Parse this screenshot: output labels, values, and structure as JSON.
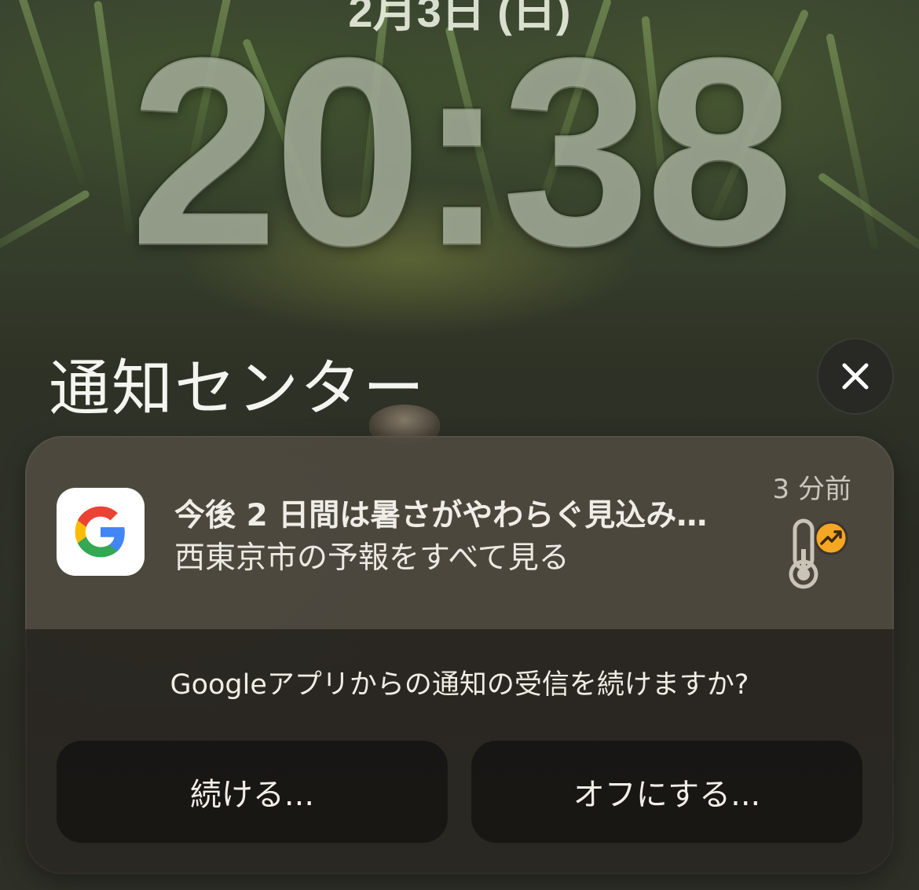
{
  "lock_screen": {
    "date": "2月3日 (日)",
    "time": "20:38"
  },
  "notification_center": {
    "title": "通知センター",
    "close_icon": "close-icon"
  },
  "notification": {
    "app_icon": "google-g-icon",
    "title": "今後 2 日間は暑さがやわらぐ見込み…",
    "body": "西東京市の予報をすべて見る",
    "time_ago": "3 分前",
    "thumbnail_icon": "thermometer-trend-up-icon",
    "accent_color": "#f5a623"
  },
  "notification_prompt": {
    "question": "Googleアプリからの通知の受信を続けますか?",
    "continue_label": "続ける...",
    "turn_off_label": "オフにする..."
  }
}
